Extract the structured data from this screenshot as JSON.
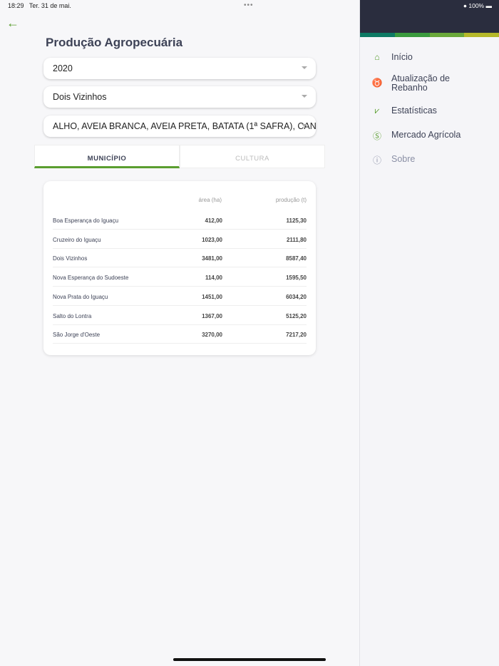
{
  "status": {
    "time": "18:29",
    "date": "Ter. 31 de mai.",
    "battery": "100%"
  },
  "page": {
    "title": "Produção Agropecuária"
  },
  "filters": {
    "year": "2020",
    "municipality": "Dois Vizinhos",
    "crops": "ALHO, AVEIA BRANCA, AVEIA PRETA, BATATA (1ª SAFRA), CANA..."
  },
  "tabs": [
    {
      "label": "MUNICÍPIO",
      "active": true
    },
    {
      "label": "CULTURA",
      "active": false
    }
  ],
  "table": {
    "headers": {
      "area": "área (ha)",
      "production": "produção (t)"
    },
    "rows": [
      {
        "name": "Boa Esperança do Iguaçu",
        "area": "412,00",
        "production": "1125,30"
      },
      {
        "name": "Cruzeiro do Iguaçu",
        "area": "1023,00",
        "production": "2111,80"
      },
      {
        "name": "Dois Vizinhos",
        "area": "3481,00",
        "production": "8587,40"
      },
      {
        "name": "Nova Esperança do Sudoeste",
        "area": "114,00",
        "production": "1595,50"
      },
      {
        "name": "Nova Prata do Iguaçu",
        "area": "1451,00",
        "production": "6034,20"
      },
      {
        "name": "Salto do Lontra",
        "area": "1367,00",
        "production": "5125,20"
      },
      {
        "name": "São Jorge d'Oeste",
        "area": "3270,00",
        "production": "7217,20"
      }
    ]
  },
  "sidebar": {
    "stripe_colors": [
      "#0e7a64",
      "#3a9a3e",
      "#6aa83a",
      "#b5b82a"
    ],
    "items": [
      {
        "label": "Início",
        "icon": "home-icon"
      },
      {
        "label": "Atualização de Rebanho",
        "icon": "cow-icon"
      },
      {
        "label": "Estatísticas",
        "icon": "chart-icon"
      },
      {
        "label": "Mercado Agrícola",
        "icon": "dollar-icon"
      },
      {
        "label": "Sobre",
        "icon": "info-icon"
      }
    ]
  },
  "colors": {
    "accent": "#5a9e2f",
    "header": "#2a2d3e"
  }
}
